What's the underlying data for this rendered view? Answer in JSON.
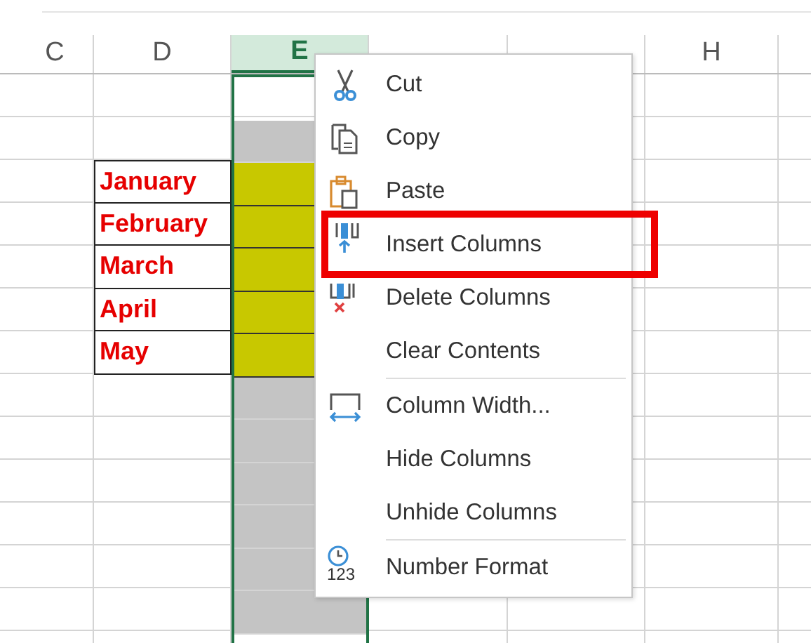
{
  "columns": [
    {
      "label": "C",
      "selected": false
    },
    {
      "label": "D",
      "selected": false
    },
    {
      "label": "E",
      "selected": true
    },
    {
      "selected": false
    },
    {
      "selected": false
    },
    {
      "label": "H",
      "selected": false
    }
  ],
  "rows": [
    {},
    {
      "color": "#c4c4c4"
    },
    {
      "month": "January",
      "color": "#c8c800"
    },
    {
      "month": "February",
      "color": "#c8c800"
    },
    {
      "month": "March",
      "color": "#c8c800"
    },
    {
      "month": "April",
      "color": "#c8c800"
    },
    {
      "month": "May",
      "color": "#c8c800"
    },
    {
      "color": "#c4c4c4"
    },
    {
      "color": "#c4c4c4"
    },
    {
      "color": "#c4c4c4"
    },
    {
      "color": "#c4c4c4"
    },
    {
      "color": "#c4c4c4"
    },
    {
      "color": "#c4c4c4"
    }
  ],
  "context_menu": [
    {
      "kind": "item",
      "label": "Cut",
      "highlighted": false
    },
    {
      "kind": "item",
      "label": "Copy",
      "highlighted": false
    },
    {
      "kind": "item",
      "label": "Paste",
      "highlighted": false
    },
    {
      "kind": "item",
      "label": "Insert Columns",
      "highlighted": true
    },
    {
      "kind": "item",
      "label": "Delete Columns",
      "highlighted": false
    },
    {
      "kind": "item",
      "label": "Clear Contents",
      "highlighted": false
    },
    {
      "kind": "separator"
    },
    {
      "kind": "item",
      "label": "Column Width...",
      "highlighted": false
    },
    {
      "kind": "item",
      "label": "Hide Columns",
      "highlighted": false
    },
    {
      "kind": "item",
      "label": "Unhide Columns",
      "highlighted": false
    },
    {
      "kind": "separator"
    },
    {
      "kind": "item",
      "label": "Number Format",
      "icon_label": "123",
      "highlighted": false
    }
  ]
}
